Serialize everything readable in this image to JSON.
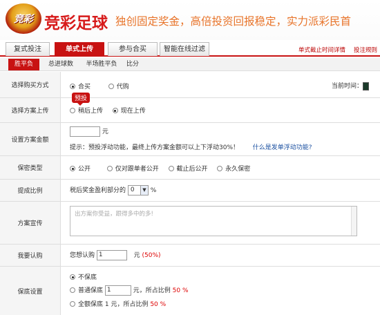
{
  "header": {
    "logo_text": "竞彩",
    "brand": "竞彩足球",
    "slogan": "独创固定奖金，高倍投资回报稳定，实力派彩民首"
  },
  "tabs": [
    {
      "label": "复式投注"
    },
    {
      "label": "单式上传"
    },
    {
      "label": "参与合买"
    },
    {
      "label": "智能在线过滤"
    }
  ],
  "toplinks": {
    "deadline": "单式截止时间详情",
    "rules": "投注规则"
  },
  "subtabs": [
    {
      "label": "胜平负"
    },
    {
      "label": "总进球数"
    },
    {
      "label": "半场胜平负"
    },
    {
      "label": "比分"
    }
  ],
  "purchase": {
    "label": "选择购买方式",
    "opt1": "合买",
    "opt2": "代购",
    "time_label": "当前时间："
  },
  "upload": {
    "label": "选择方案上传",
    "badge": "预投",
    "opt1": "稍后上传",
    "opt2": "现在上传"
  },
  "amount": {
    "label": "设置方案金额",
    "value": "",
    "unit": "元",
    "hint": "提示：预投浮动功能，最终上传方案金额可以上下浮动30%！",
    "link": "什么是发单浮动功能?"
  },
  "privacy": {
    "label": "保密类型",
    "opt1": "公开",
    "opt2": "仅对跟单者公开",
    "opt3": "截止后公开",
    "opt4": "永久保密"
  },
  "commission": {
    "label": "提成比例",
    "prefix": "税后奖金盈利部分的",
    "value": "0",
    "unit": "%"
  },
  "promo": {
    "label": "方案宣传",
    "placeholder": "出方案你受益，跟得多中的多!"
  },
  "subscribe": {
    "label": "我要认购",
    "prefix": "您想认购",
    "value": "1",
    "unit": "元",
    "pct": "(50%)"
  },
  "guarantee": {
    "label": "保底设置",
    "opt1": "不保底",
    "opt2_prefix": "普通保底",
    "opt2_value": "1",
    "opt2_mid": "元，所占比例",
    "opt2_pct": "50 %",
    "opt3_prefix": "全额保底 1 元，所占比例",
    "opt3_pct": "50 %"
  }
}
